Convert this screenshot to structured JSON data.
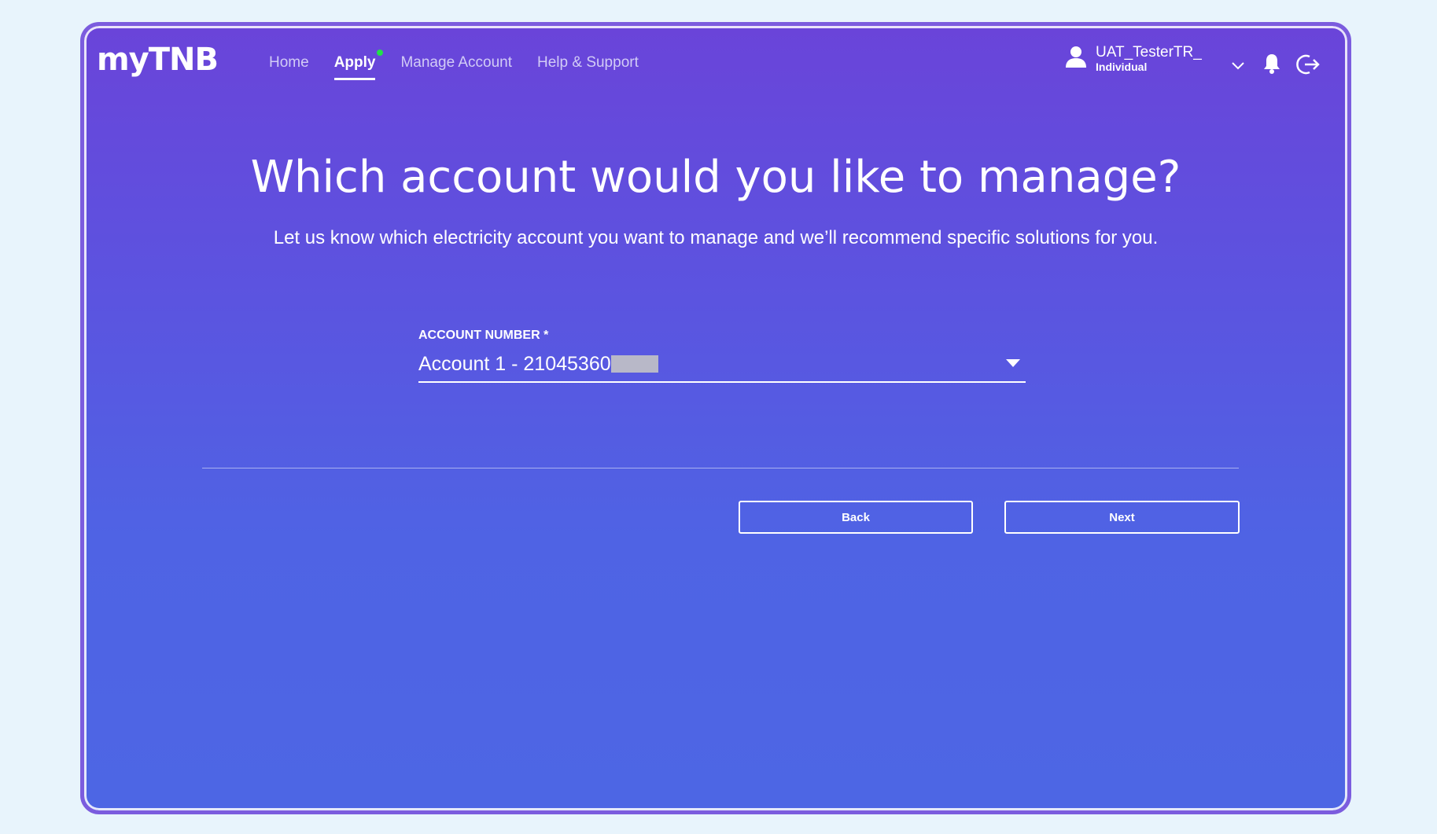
{
  "header": {
    "logo": "myTNB",
    "nav": [
      {
        "label": "Home",
        "active": false
      },
      {
        "label": "Apply",
        "active": true
      },
      {
        "label": "Manage Account",
        "active": false
      },
      {
        "label": "Help & Support",
        "active": false
      }
    ],
    "user": {
      "name": "UAT_TesterTR_",
      "type": "Individual"
    },
    "icons": {
      "user": "user-icon",
      "dropdown": "chevron-down-icon",
      "notifications": "bell-icon",
      "logout": "logout-icon"
    }
  },
  "main": {
    "title": "Which account would you like to manage?",
    "subtitle": "Let us know which electricity account you want to manage and we’ll recommend specific solutions for you.",
    "account_field": {
      "label": "ACCOUNT NUMBER *",
      "value": "Account 1 - 21045360"
    },
    "buttons": {
      "back": "Back",
      "next": "Next"
    }
  },
  "colors": {
    "accent": "#6a44d9",
    "new_indicator": "#22e04a"
  }
}
